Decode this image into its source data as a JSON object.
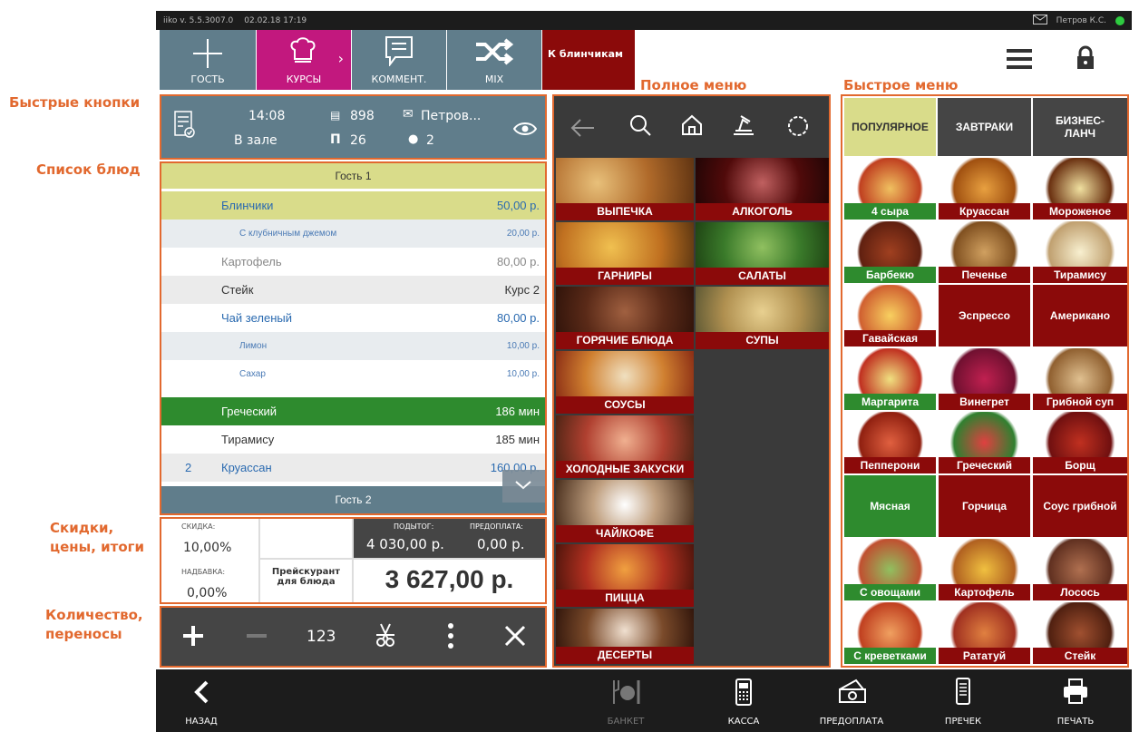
{
  "status_bar": {
    "version": "iiko v. 5.5.3007.0",
    "datetime": "02.02.18 17:19",
    "user": "Петров К.С."
  },
  "annotations": {
    "quick_buttons": "Быстрые кнопки",
    "dish_list": "Список блюд",
    "discounts": "Скидки, цены, итоги",
    "quantity": "Количество, переносы",
    "full_menu": "Полное меню",
    "quick_menu": "Быстрое меню"
  },
  "toolbar": {
    "guest": "ГОСТЬ",
    "courses": "КУРСЫ",
    "comment": "КОММЕНТ.",
    "mix": "MIX",
    "shortcut": "К блинчикам"
  },
  "order_header": {
    "time": "14:08",
    "place": "В зале",
    "check_no": "898",
    "table": "26",
    "waiter": "Петров...",
    "guests": "2"
  },
  "guest1_label": "Гость 1",
  "guest2_label": "Гость 2",
  "items": [
    {
      "qty": "",
      "name": "Блинчики",
      "price": "50,00 р."
    },
    {
      "qty": "",
      "name": "С клубничным джемом",
      "price": "20,00 р."
    },
    {
      "qty": "",
      "name": "Картофель",
      "price": "80,00 р."
    },
    {
      "qty": "",
      "name": "Стейк",
      "price": "Курс 2"
    },
    {
      "qty": "",
      "name": "Чай зеленый",
      "price": "80,00 р."
    },
    {
      "qty": "",
      "name": "Лимон",
      "price": "10,00 р."
    },
    {
      "qty": "",
      "name": "Сахар",
      "price": "10,00 р."
    },
    {
      "qty": "",
      "name": "Греческий",
      "price": "186 мин"
    },
    {
      "qty": "",
      "name": "Тирамису",
      "price": "185 мин"
    },
    {
      "qty": "2",
      "name": "Круассан",
      "price": "160,00 р."
    }
  ],
  "totals": {
    "discount_label": "СКИДКА:",
    "discount": "10,00%",
    "surcharge_label": "НАДБАВКА:",
    "surcharge": "0,00%",
    "pricelist": "Прейскурант для блюда",
    "subtotal_label": "ПОДЫТОГ:",
    "subtotal": "4 030,00 р.",
    "prepay_label": "ПРЕДОПЛАТА:",
    "prepay": "0,00 р.",
    "total": "3 627,00 р."
  },
  "qty_bar": {
    "count_label": "123"
  },
  "full_menu": [
    "ВЫПЕЧКА",
    "АЛКОГОЛЬ",
    "ГАРНИРЫ",
    "САЛАТЫ",
    "ГОРЯЧИЕ БЛЮДА",
    "СУПЫ",
    "СОУСЫ",
    "ХОЛОДНЫЕ ЗАКУСКИ",
    "ЧАЙ/КОФЕ",
    "ПИЦЦА",
    "ДЕСЕРТЫ"
  ],
  "quick_tabs": [
    "ПОПУЛЯРНОЕ",
    "ЗАВТРАКИ",
    "БИЗНЕС-ЛАНЧ"
  ],
  "quick_items": [
    "4 сыра",
    "Круассан",
    "Мороженое",
    "Барбекю",
    "Печенье",
    "Тирамису",
    "Гавайская",
    "Эспрессо",
    "Американо",
    "Маргарита",
    "Винегрет",
    "Грибной суп",
    "Пепперони",
    "Греческий",
    "Борщ",
    "Мясная",
    "Горчица",
    "Соус грибной",
    "С овощами",
    "Картофель",
    "Лосось",
    "С креветками",
    "Рататуй",
    "Стейк"
  ],
  "bottom": {
    "back": "НАЗАД",
    "banquet": "БАНКЕТ",
    "cash": "КАССА",
    "prepay": "ПРЕДОПЛАТА",
    "precheck": "ПРЕЧЕК",
    "print": "ПЕЧАТЬ"
  },
  "colors": {
    "accent": "#e2692f",
    "courses": "#c2187e",
    "crimson": "#8b0a0a",
    "slate": "#607d8b",
    "green": "#2e8b2e",
    "highlight": "#d9dc8a"
  }
}
